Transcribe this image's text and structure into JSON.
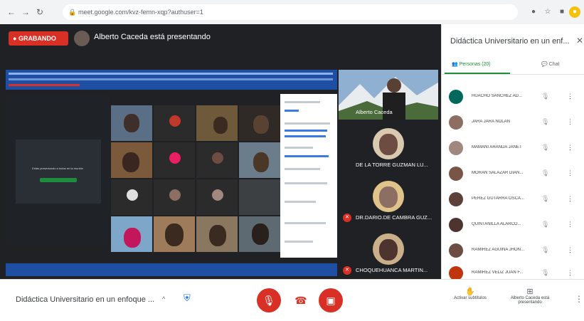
{
  "browser": {
    "url": "meet.google.com/kvz-femn-xqp?authuser=1"
  },
  "stage": {
    "recording_label": "GRABANDO",
    "presenting_text": "Alberto Caceda está presentando",
    "shared_caption": "Estás presentando a todos en la reunión"
  },
  "tiles": [
    {
      "name": "Alberto Caceda"
    },
    {
      "name": "DE LA TORRE GUZMAN LU..."
    },
    {
      "name": "DR.DARIO.DE CAMBRA GUZ..."
    },
    {
      "name": "CHOQUEHUANCA MARTIN..."
    }
  ],
  "sidebar": {
    "title": "Didáctica Universitario en un enf...",
    "tab_people": "Personas (20)",
    "tab_chat": "Chat",
    "participants": [
      {
        "name": "HUACHO SANCHEZ AD...",
        "color": "#00695c"
      },
      {
        "name": "JARA JARA NOLAN",
        "color": "#8d6e63"
      },
      {
        "name": "MAMANI ARANDA JANET",
        "color": "#a1887f"
      },
      {
        "name": "MORAN SALAZAR DIAN...",
        "color": "#795548"
      },
      {
        "name": "PEREZ GUTARRA OSCA...",
        "color": "#5d4037"
      },
      {
        "name": "QUINTANILLA ALARCO...",
        "color": "#4e342e"
      },
      {
        "name": "RAMIREZ AGUIÑA JHON...",
        "color": "#6d4c41"
      },
      {
        "name": "RAMIREZ VELIZ JUAN F...",
        "color": "#bf360c"
      }
    ]
  },
  "bottom": {
    "meeting_title": "Didáctica Universitario en un enfoque ...",
    "turn_on_captions": "Activar subtítulos",
    "presenter_label": "Alberto Caceda está presentando"
  }
}
